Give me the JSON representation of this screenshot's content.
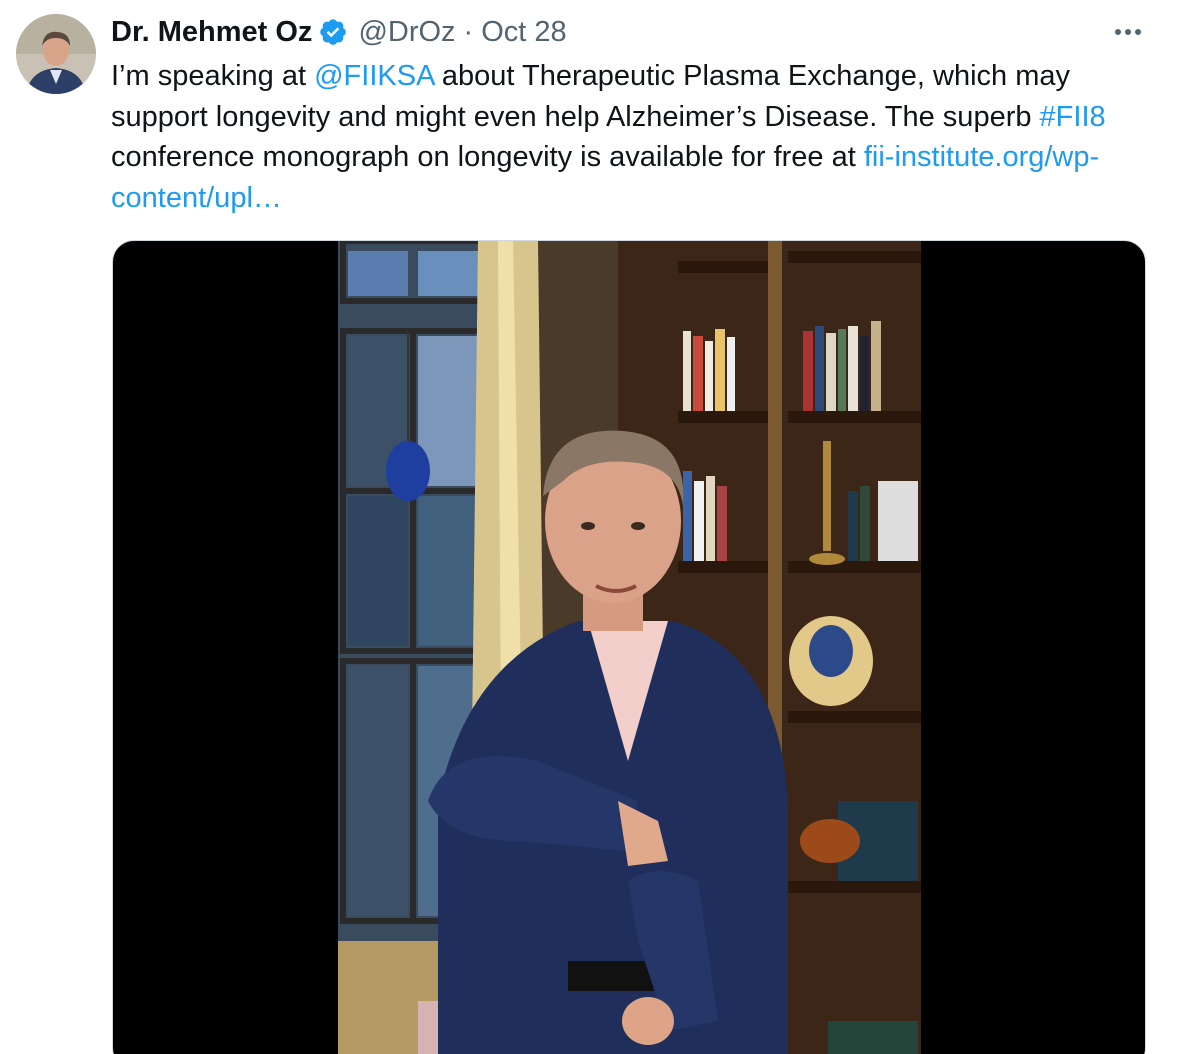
{
  "tweet": {
    "author_name": "Dr. Mehmet Oz",
    "handle": "@DrOz",
    "separator": "·",
    "date": "Oct 28",
    "verified": true,
    "more_label": "•••",
    "text_segments": [
      {
        "text": "I’m speaking at ",
        "type": "text"
      },
      {
        "text": "@FIIKSA",
        "type": "mention"
      },
      {
        "text": " about Therapeutic Plasma Exchange, which may support longevity and might even help Alzheimer’s Disease. The superb ",
        "type": "text"
      },
      {
        "text": "#FII8",
        "type": "hashtag"
      },
      {
        "text": " conference monograph on longevity is available for free at ",
        "type": "text"
      },
      {
        "text": "fii-institute.org/wp-content/upl…",
        "type": "url"
      }
    ]
  },
  "icons": {
    "avatar": "profile-photo",
    "verified": "verified-badge-icon",
    "more": "more-horizontal-icon"
  },
  "colors": {
    "link": "#1d9bf0",
    "text": "#0f1419",
    "secondary": "#536471",
    "media_bg": "#000000"
  }
}
